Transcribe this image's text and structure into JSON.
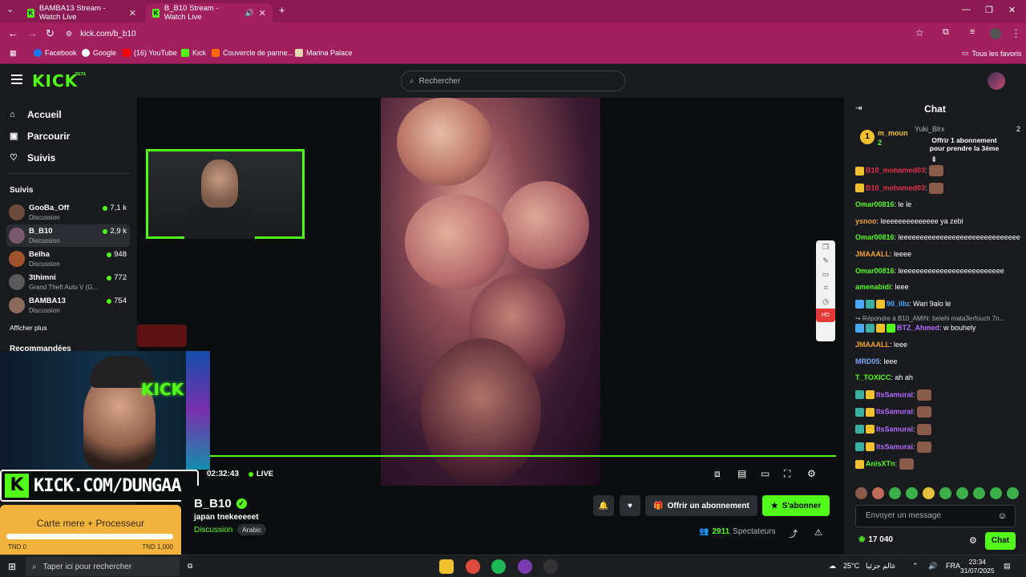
{
  "browser": {
    "tabs": [
      {
        "title": "BAMBA13 Stream - Watch Live",
        "active": false
      },
      {
        "title": "B_B10 Stream - Watch Live",
        "active": true
      }
    ],
    "url": "kick.com/b_b10",
    "bookmarks": [
      "Facebook",
      "Google",
      "(16) YouTube",
      "Kick",
      "Couvercle de panne...",
      "Marina Palace"
    ],
    "all_bookmarks": "Tous les favoris"
  },
  "header": {
    "logo": "KICK",
    "beta": "BETA",
    "search_placeholder": "Rechercher"
  },
  "sidebar": {
    "nav": [
      {
        "label": "Accueil",
        "icon": "home-icon"
      },
      {
        "label": "Parcourir",
        "icon": "browse-icon"
      },
      {
        "label": "Suivis",
        "icon": "heart-icon"
      }
    ],
    "following_title": "Suivis",
    "channels": [
      {
        "name": "GooBa_Off",
        "category": "Discussion",
        "viewers": "7,1 k",
        "color": "#6b4a3a"
      },
      {
        "name": "B_B10",
        "category": "Discussion",
        "viewers": "2,9 k",
        "color": "#7a5a6a",
        "active": true
      },
      {
        "name": "Belha",
        "category": "Discussion",
        "viewers": "948",
        "color": "#a0522d"
      },
      {
        "name": "3thimni",
        "category": "Grand Theft Auto V (G...",
        "viewers": "772",
        "color": "#5a5a5a"
      },
      {
        "name": "BAMBA13",
        "category": "Discussion",
        "viewers": "754",
        "color": "#8a6a5a"
      }
    ],
    "show_more": "Afficher plus",
    "recommended_title": "Recommandées"
  },
  "player": {
    "time": "02:32:43",
    "live": "LIVE"
  },
  "overlay": {
    "banner": "KICK.COM/DUNGAA",
    "goal_title": "Carte mere + Processeur",
    "goal_min": "TND 0",
    "goal_max": "TND 1,000",
    "goal_progress": 0.0
  },
  "channel": {
    "name": "B_B10",
    "title": "japan tnekeeeeet",
    "category": "Discussion",
    "tag": "Arabic",
    "gift_label": "Offrir un abonnement",
    "subscribe_label": "S'abonner",
    "viewers": "2911",
    "viewers_label": "Spectateurs"
  },
  "chat": {
    "title": "Chat",
    "pinned": {
      "rank": "1",
      "user": "m_moun",
      "subs": "2",
      "gifter": "Yuki_Blrx",
      "gifter_count": "2",
      "text": "Offrir 1 abonnement pour prendre la 3ème"
    },
    "messages": [
      {
        "user": "B10_mohamed03",
        "color": "#e5304b",
        "text": "",
        "emote": true,
        "badges": [
          "#f2c12e"
        ]
      },
      {
        "user": "B10_mohamed03",
        "color": "#e5304b",
        "text": "",
        "emote": true,
        "badges": [
          "#f2c12e"
        ]
      },
      {
        "user": "Omar00816",
        "color": "#53fc18",
        "text": "le le",
        "badges": []
      },
      {
        "user": "ysnoo",
        "color": "#f2a12e",
        "text": "leeeeeeeeeeeeee ya zebi",
        "badges": []
      },
      {
        "user": "Omar00816",
        "color": "#53fc18",
        "text": "leeeeeeeeeeeeeeeeeeeeeeeeeeeeee",
        "badges": []
      },
      {
        "user": "JMAAALL",
        "color": "#f2a12e",
        "text": "leeee",
        "badges": []
      },
      {
        "user": "Omar00816",
        "color": "#53fc18",
        "text": "leeeeeeeeeeeeeeeeeeeeeeeeee",
        "badges": []
      },
      {
        "user": "amenabidi",
        "color": "#53fc18",
        "text": "leee",
        "badges": []
      },
      {
        "user": "90_illu",
        "color": "#4aa8ff",
        "text": "Wari 9alo le",
        "badges": [
          "#4aa8ff",
          "#3bb0a0",
          "#f2c12e"
        ]
      },
      {
        "user": "BTZ_Ahmed",
        "color": "#b36bff",
        "text": "w bouhely",
        "badges": [
          "#4aa8ff",
          "#3bb0a0",
          "#f2c12e",
          "#53fc18"
        ],
        "reply": "Répondre à B10_AMIN: belehi mata3erfouch 7n..."
      },
      {
        "user": "JMAAALL",
        "color": "#f2a12e",
        "text": "leee",
        "badges": []
      },
      {
        "user": "MRD05",
        "color": "#7fa8ff",
        "text": "leee",
        "badges": []
      },
      {
        "user": "T_TOXICC",
        "color": "#53fc18",
        "text": "ah ah",
        "badges": []
      },
      {
        "user": "ItsSamurai",
        "color": "#b36bff",
        "text": "",
        "emote": true,
        "badges": [
          "#3bb0a0",
          "#f2c12e"
        ]
      },
      {
        "user": "ItsSamurai",
        "color": "#b36bff",
        "text": "",
        "emote": true,
        "badges": [
          "#3bb0a0",
          "#f2c12e"
        ]
      },
      {
        "user": "ItsSamurai",
        "color": "#b36bff",
        "text": "",
        "emote": true,
        "badges": [
          "#3bb0a0",
          "#f2c12e"
        ]
      },
      {
        "user": "ItsSamurai",
        "color": "#b36bff",
        "text": "",
        "emote": true,
        "badges": [
          "#3bb0a0",
          "#f2c12e"
        ]
      },
      {
        "user": "AnisXTn",
        "color": "#53fc18",
        "text": "",
        "emote": true,
        "badges": [
          "#f2c12e"
        ]
      }
    ],
    "input_placeholder": "Envoyer un message",
    "points": "17 040",
    "send_label": "Chat"
  },
  "taskbar": {
    "search_placeholder": "Taper ici pour rechercher",
    "weather": "25°C",
    "weather_text": "عالم جزئيا",
    "lang": "FRA",
    "time": "23:34",
    "date": "31/07/2025"
  },
  "colors": {
    "kick_green": "#53fc18",
    "chrome": "#a3205f",
    "tab_bar": "#8b1a52",
    "panel": "#191b1f"
  }
}
